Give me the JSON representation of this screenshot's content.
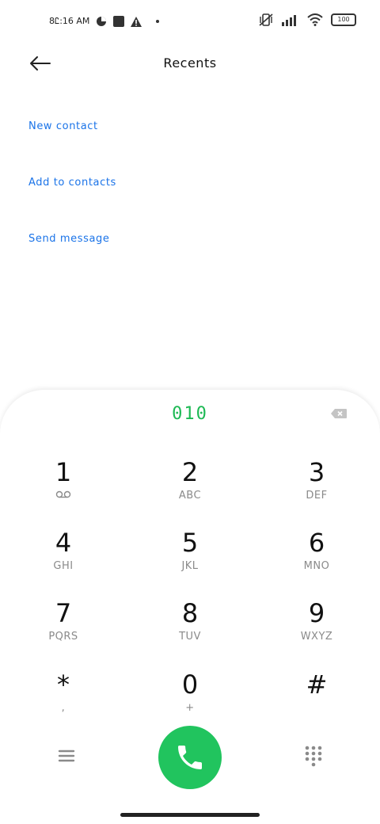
{
  "status_bar": {
    "time": "8Ꮭ:16 AM",
    "battery": "100"
  },
  "header": {
    "title": "Recents"
  },
  "actions": [
    {
      "label": "New contact"
    },
    {
      "label": "Add to contacts"
    },
    {
      "label": "Send message"
    }
  ],
  "dialer": {
    "number": "010",
    "keys": [
      {
        "digit": "1",
        "sub": ""
      },
      {
        "digit": "2",
        "sub": "ABC"
      },
      {
        "digit": "3",
        "sub": "DEF"
      },
      {
        "digit": "4",
        "sub": "GHI"
      },
      {
        "digit": "5",
        "sub": "JKL"
      },
      {
        "digit": "6",
        "sub": "MNO"
      },
      {
        "digit": "7",
        "sub": "PQRS"
      },
      {
        "digit": "8",
        "sub": "TUV"
      },
      {
        "digit": "9",
        "sub": "WXYZ"
      },
      {
        "digit": "*",
        "sub": ","
      },
      {
        "digit": "0",
        "sub": "+"
      },
      {
        "digit": "#",
        "sub": ""
      }
    ]
  },
  "colors": {
    "accent_blue": "#1a73e8",
    "call_green": "#21c45e",
    "number_green": "#1db954"
  }
}
